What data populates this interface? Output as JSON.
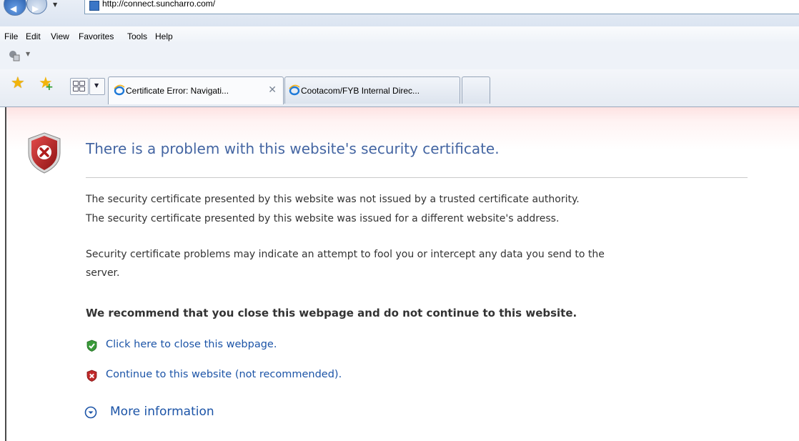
{
  "browser": {
    "address_url": "http://connect.suncharro.com/",
    "menu": [
      "File",
      "Edit",
      "View",
      "Favorites",
      "Tools",
      "Help"
    ],
    "tabs": [
      {
        "title": "Certificate Error: Navigati...",
        "active": true
      },
      {
        "title": "Cootacom/FYB Internal Direc...",
        "active": false
      }
    ],
    "icons": {
      "back": "back-arrow-icon",
      "forward": "forward-arrow-icon",
      "favorites": "favorites-star-icon",
      "add_favorite": "add-favorite-icon",
      "quick_tabs": "quick-tabs-icon",
      "tab_list": "tab-list-icon",
      "ie": "internet-explorer-icon"
    }
  },
  "page": {
    "heading": "There is a problem with this website's security certificate.",
    "lines": [
      "The security certificate presented by this website was not issued by a trusted certificate authority.",
      "The security certificate presented by this website was issued for a different website's address.",
      "Security certificate problems may indicate an attempt to fool you or intercept any data you send to the",
      "server."
    ],
    "recommendation": "We recommend that you close this webpage and do not continue to this website.",
    "close_link": "Click here to close this webpage.",
    "continue_link": "Continue to this website (not recommended).",
    "more_info": "More information",
    "colors": {
      "heading": "#4465a2",
      "link": "#1c54a7",
      "shield_error": "#c0292a",
      "shield_ok": "#3a9a3a"
    }
  }
}
